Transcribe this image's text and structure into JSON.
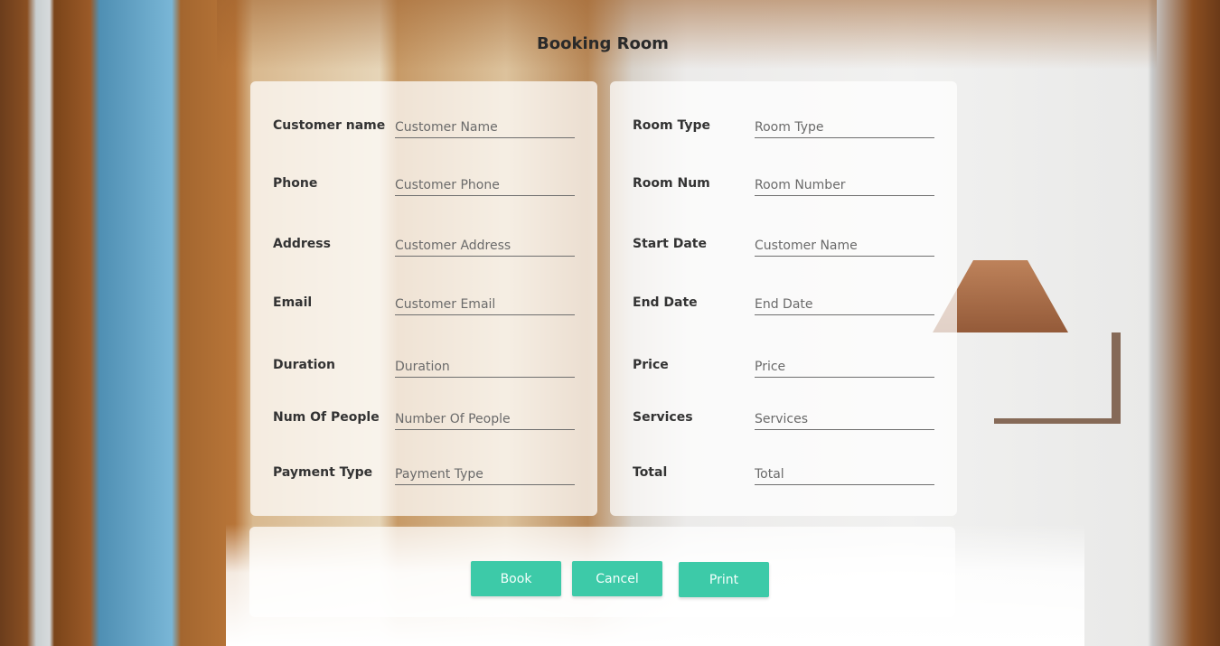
{
  "title": "Booking Room",
  "left_form": [
    {
      "label": "Customer name",
      "placeholder": "Customer Name"
    },
    {
      "label": "Phone",
      "placeholder": "Customer Phone"
    },
    {
      "label": "Address",
      "placeholder": "Customer Address"
    },
    {
      "label": "Email",
      "placeholder": "Customer Email"
    },
    {
      "label": "Duration",
      "placeholder": "Duration"
    },
    {
      "label": "Num Of People",
      "placeholder": "Number Of People"
    },
    {
      "label": "Payment Type",
      "placeholder": "Payment Type"
    }
  ],
  "right_form": [
    {
      "label": "Room Type",
      "placeholder": "Room Type"
    },
    {
      "label": "Room Num",
      "placeholder": "Room Number"
    },
    {
      "label": "Start Date",
      "placeholder": "Customer Name"
    },
    {
      "label": "End Date",
      "placeholder": "End Date"
    },
    {
      "label": "Price",
      "placeholder": "Price"
    },
    {
      "label": "Services",
      "placeholder": "Services"
    },
    {
      "label": "Total",
      "placeholder": "Total"
    }
  ],
  "buttons": {
    "book": "Book",
    "cancel": "Cancel",
    "print": "Print"
  },
  "colors": {
    "button": "#3dcaa8",
    "panel": "rgba(255,255,255,0.72)"
  }
}
